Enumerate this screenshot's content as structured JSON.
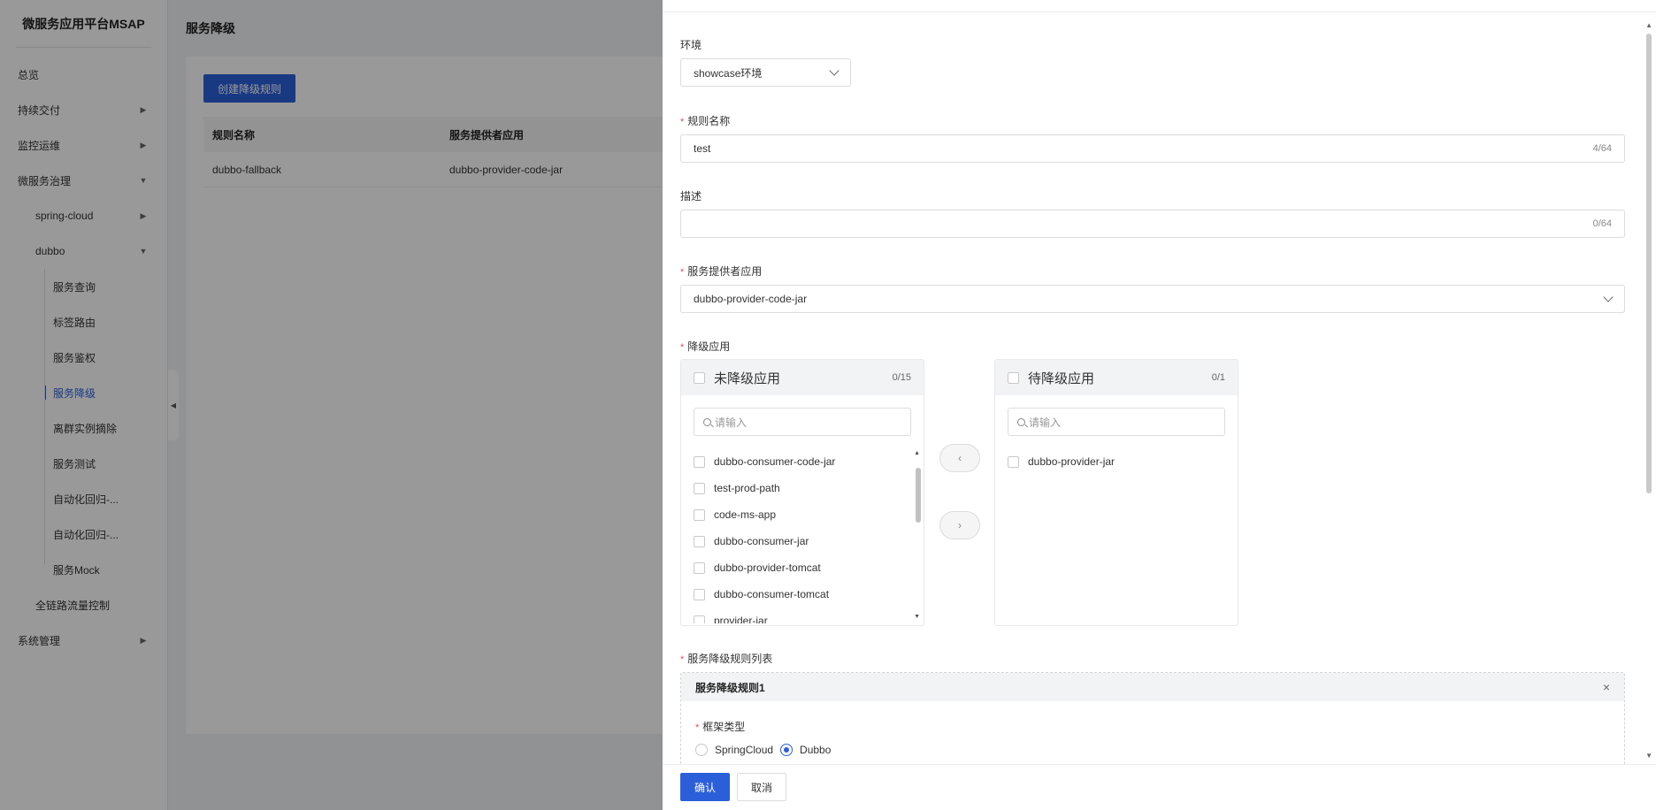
{
  "sidebar": {
    "brand": "微服务应用平台MSAP",
    "items": [
      {
        "label": "总览"
      },
      {
        "label": "持续交付"
      },
      {
        "label": "监控运维"
      },
      {
        "label": "微服务治理"
      },
      {
        "label": "spring-cloud"
      },
      {
        "label": "dubbo"
      },
      {
        "label": "服务查询"
      },
      {
        "label": "标签路由"
      },
      {
        "label": "服务鉴权"
      },
      {
        "label": "服务降级"
      },
      {
        "label": "离群实例摘除"
      },
      {
        "label": "服务测试"
      },
      {
        "label": "自动化回归-..."
      },
      {
        "label": "自动化回归-..."
      },
      {
        "label": "服务Mock"
      },
      {
        "label": "全链路流量控制"
      },
      {
        "label": "系统管理"
      }
    ]
  },
  "main": {
    "title": "服务降级",
    "create_button": "创建降级规则",
    "table": {
      "columns": [
        "规则名称",
        "服务提供者应用"
      ],
      "rows": [
        [
          "dubbo-fallback",
          "dubbo-provider-code-jar"
        ]
      ]
    }
  },
  "drawer": {
    "env": {
      "label": "环境",
      "value": "showcase环境"
    },
    "rule_name": {
      "label": "规则名称",
      "value": "test",
      "counter": "4/64"
    },
    "description": {
      "label": "描述",
      "value": "",
      "counter": "0/64"
    },
    "provider": {
      "label": "服务提供者应用",
      "value": "dubbo-provider-code-jar"
    },
    "degrade_apps": {
      "label": "降级应用",
      "left": {
        "title": "未降级应用",
        "count": "0/15",
        "placeholder": "请输入",
        "items": [
          "dubbo-consumer-code-jar",
          "test-prod-path",
          "code-ms-app",
          "dubbo-consumer-jar",
          "dubbo-provider-tomcat",
          "dubbo-consumer-tomcat",
          "provider-jar"
        ]
      },
      "right": {
        "title": "待降级应用",
        "count": "0/1",
        "placeholder": "请输入",
        "items": [
          "dubbo-provider-jar"
        ]
      },
      "move_left": "‹",
      "move_right": "›"
    },
    "rule_list": {
      "label": "服务降级规则列表",
      "rule_title": "服务降级规则1",
      "framework_label": "框架类型",
      "options": [
        "SpringCloud",
        "Dubbo"
      ],
      "selected": "Dubbo"
    },
    "footer": {
      "confirm": "确认",
      "cancel": "取消"
    }
  },
  "colors": {
    "primary": "#2b5fd9",
    "required": "#e34d59"
  }
}
